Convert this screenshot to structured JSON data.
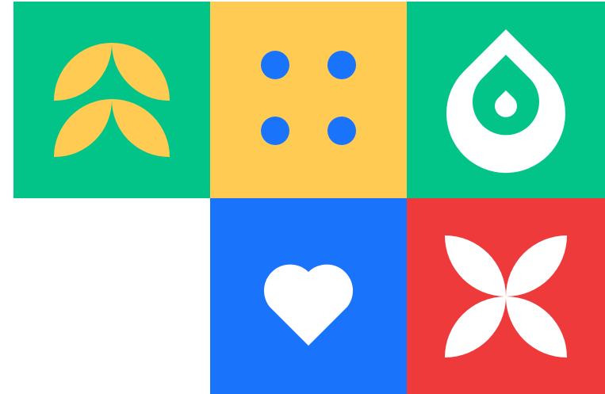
{
  "colors": {
    "green": "#03C488",
    "yellow": "#FFCB52",
    "blue": "#1A73FB",
    "red": "#EF3A3C",
    "white": "#FFFFFF",
    "background": "#FFFFFF"
  },
  "tiles": [
    {
      "name": "tile-leaves",
      "icon": "sprout-leaves-icon",
      "background": "#03C488",
      "foreground": "#FFCB52"
    },
    {
      "name": "tile-dots",
      "icon": "four-dots-icon",
      "background": "#FFCB52",
      "foreground": "#1A73FB"
    },
    {
      "name": "tile-drop",
      "icon": "water-drop-icon",
      "background": "#03C488",
      "foreground": "#FFFFFF"
    },
    {
      "name": "tile-heart",
      "icon": "heart-icon",
      "background": "#1A73FB",
      "foreground": "#FFFFFF"
    },
    {
      "name": "tile-petals",
      "icon": "four-petals-icon",
      "background": "#EF3A3C",
      "foreground": "#FFFFFF"
    }
  ]
}
